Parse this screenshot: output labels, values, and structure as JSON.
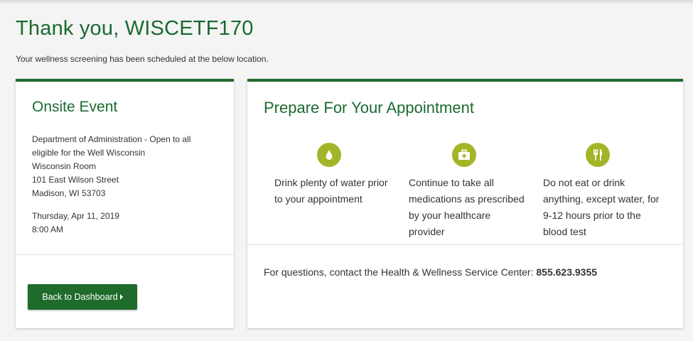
{
  "header": {
    "title": "Thank you, WISCETF170",
    "subtitle": "Your wellness screening has been scheduled at the below location."
  },
  "event_card": {
    "heading": "Onsite Event",
    "location_lines": [
      "Department of Administration - Open to all",
      "eligible for the Well Wisconsin",
      "Wisconsin Room",
      "101 East Wilson Street",
      "Madison, WI 53703"
    ],
    "date": "Thursday, Apr 11, 2019",
    "time": "8:00 AM",
    "dashboard_button_label": "Back to Dashboard"
  },
  "prepare_card": {
    "heading": "Prepare For Your Appointment",
    "tips": [
      {
        "icon": "water-drop-icon",
        "text": "Drink plenty of water prior to your appointment"
      },
      {
        "icon": "medical-kit-icon",
        "text": "Continue to take all medications as prescribed by your healthcare provider"
      },
      {
        "icon": "fork-knife-icon",
        "text": "Do not eat or drink anything, except water, for 9-12 hours prior to the blood test"
      }
    ],
    "contact_text": "For questions, contact the Health & Wellness Service Center:",
    "contact_phone": "855.623.9355"
  },
  "colors": {
    "brand_green": "#1b6a30",
    "button_green": "#1f6b2c",
    "icon_olive": "#a3b527"
  }
}
